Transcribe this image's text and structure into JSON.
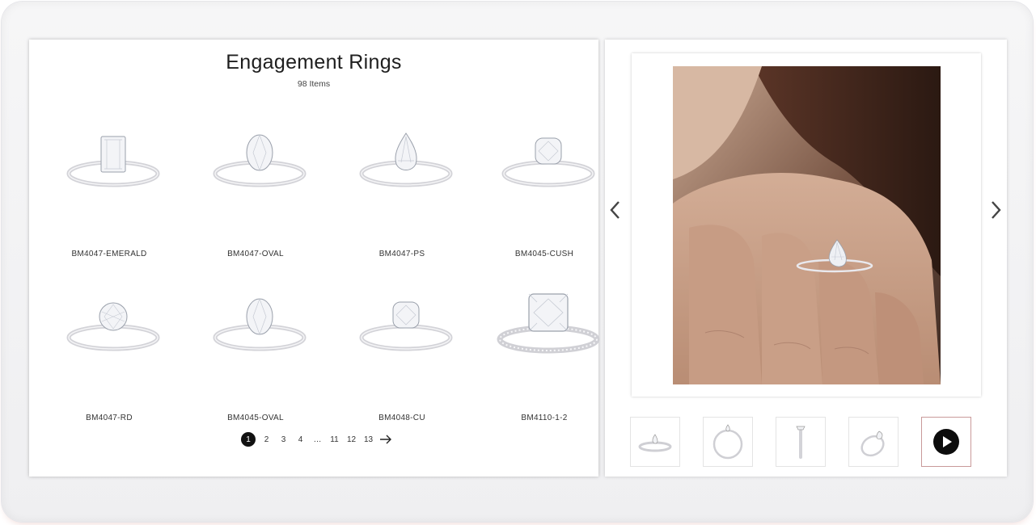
{
  "catalog": {
    "title": "Engagement Rings",
    "item_count": "98 Items",
    "products": [
      {
        "sku": "BM4047-EMERALD",
        "cut": "emerald"
      },
      {
        "sku": "BM4047-OVAL",
        "cut": "oval"
      },
      {
        "sku": "BM4047-PS",
        "cut": "pear"
      },
      {
        "sku": "BM4045-CUSH",
        "cut": "cushion"
      },
      {
        "sku": "BM4047-RD",
        "cut": "round"
      },
      {
        "sku": "BM4045-OVAL",
        "cut": "oval"
      },
      {
        "sku": "BM4048-CU",
        "cut": "cushion"
      },
      {
        "sku": "BM4110-1-2",
        "cut": "cushion-pave"
      }
    ],
    "pagination": {
      "current": "1",
      "pages": [
        "1",
        "2",
        "3",
        "4",
        "…",
        "11",
        "12",
        "13"
      ],
      "next_icon": "arrow-right-icon"
    }
  },
  "viewer": {
    "main_image": "hand-wearing-pear-ring",
    "prev_icon": "chevron-left-icon",
    "next_icon": "chevron-right-icon",
    "thumbnails": [
      {
        "name": "thumb-front-view",
        "selected": false
      },
      {
        "name": "thumb-side-view",
        "selected": false
      },
      {
        "name": "thumb-profile-view",
        "selected": false
      },
      {
        "name": "thumb-angle-view",
        "selected": false
      },
      {
        "name": "thumb-video",
        "selected": true,
        "icon": "play-icon"
      }
    ]
  },
  "colors": {
    "accent": "#111111",
    "thumb_selected_border": "#c99a9a",
    "metal": "#d8d8dc"
  }
}
